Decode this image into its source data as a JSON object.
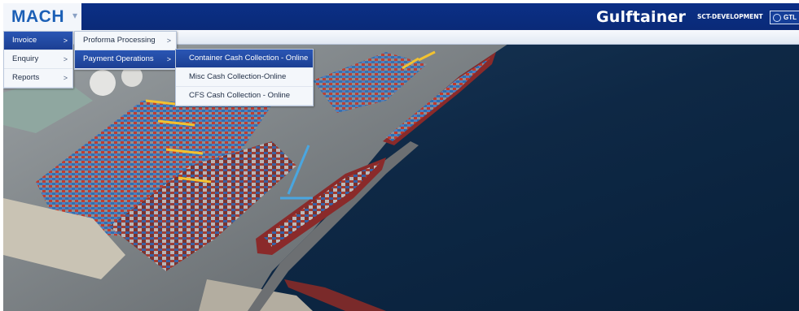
{
  "header": {
    "logo": "MACH",
    "brand": "Gulftainer",
    "environment": "SCT-DEVELOPMENT",
    "user_label": "GTL"
  },
  "main_menu": {
    "items": [
      {
        "label": "Invoice",
        "arrow": ">",
        "active": true
      },
      {
        "label": "Enquiry",
        "arrow": ">",
        "active": false
      },
      {
        "label": "Reports",
        "arrow": ">",
        "active": false
      }
    ]
  },
  "invoice_menu": {
    "items": [
      {
        "label": "Proforma Processing",
        "arrow": ">",
        "active": false
      },
      {
        "label": "Payment Operations",
        "arrow": ">",
        "active": true
      }
    ]
  },
  "payment_menu": {
    "items": [
      {
        "label": "Container Cash Collection - Online",
        "active": true
      },
      {
        "label": "Misc Cash Collection-Online",
        "active": false
      },
      {
        "label": "CFS Cash Collection - Online",
        "active": false
      }
    ]
  },
  "colors": {
    "header": "#0a2a78",
    "logo": "#1b5fb6",
    "menu_active": "#1c3f93",
    "sea": "#0d2a4a"
  }
}
